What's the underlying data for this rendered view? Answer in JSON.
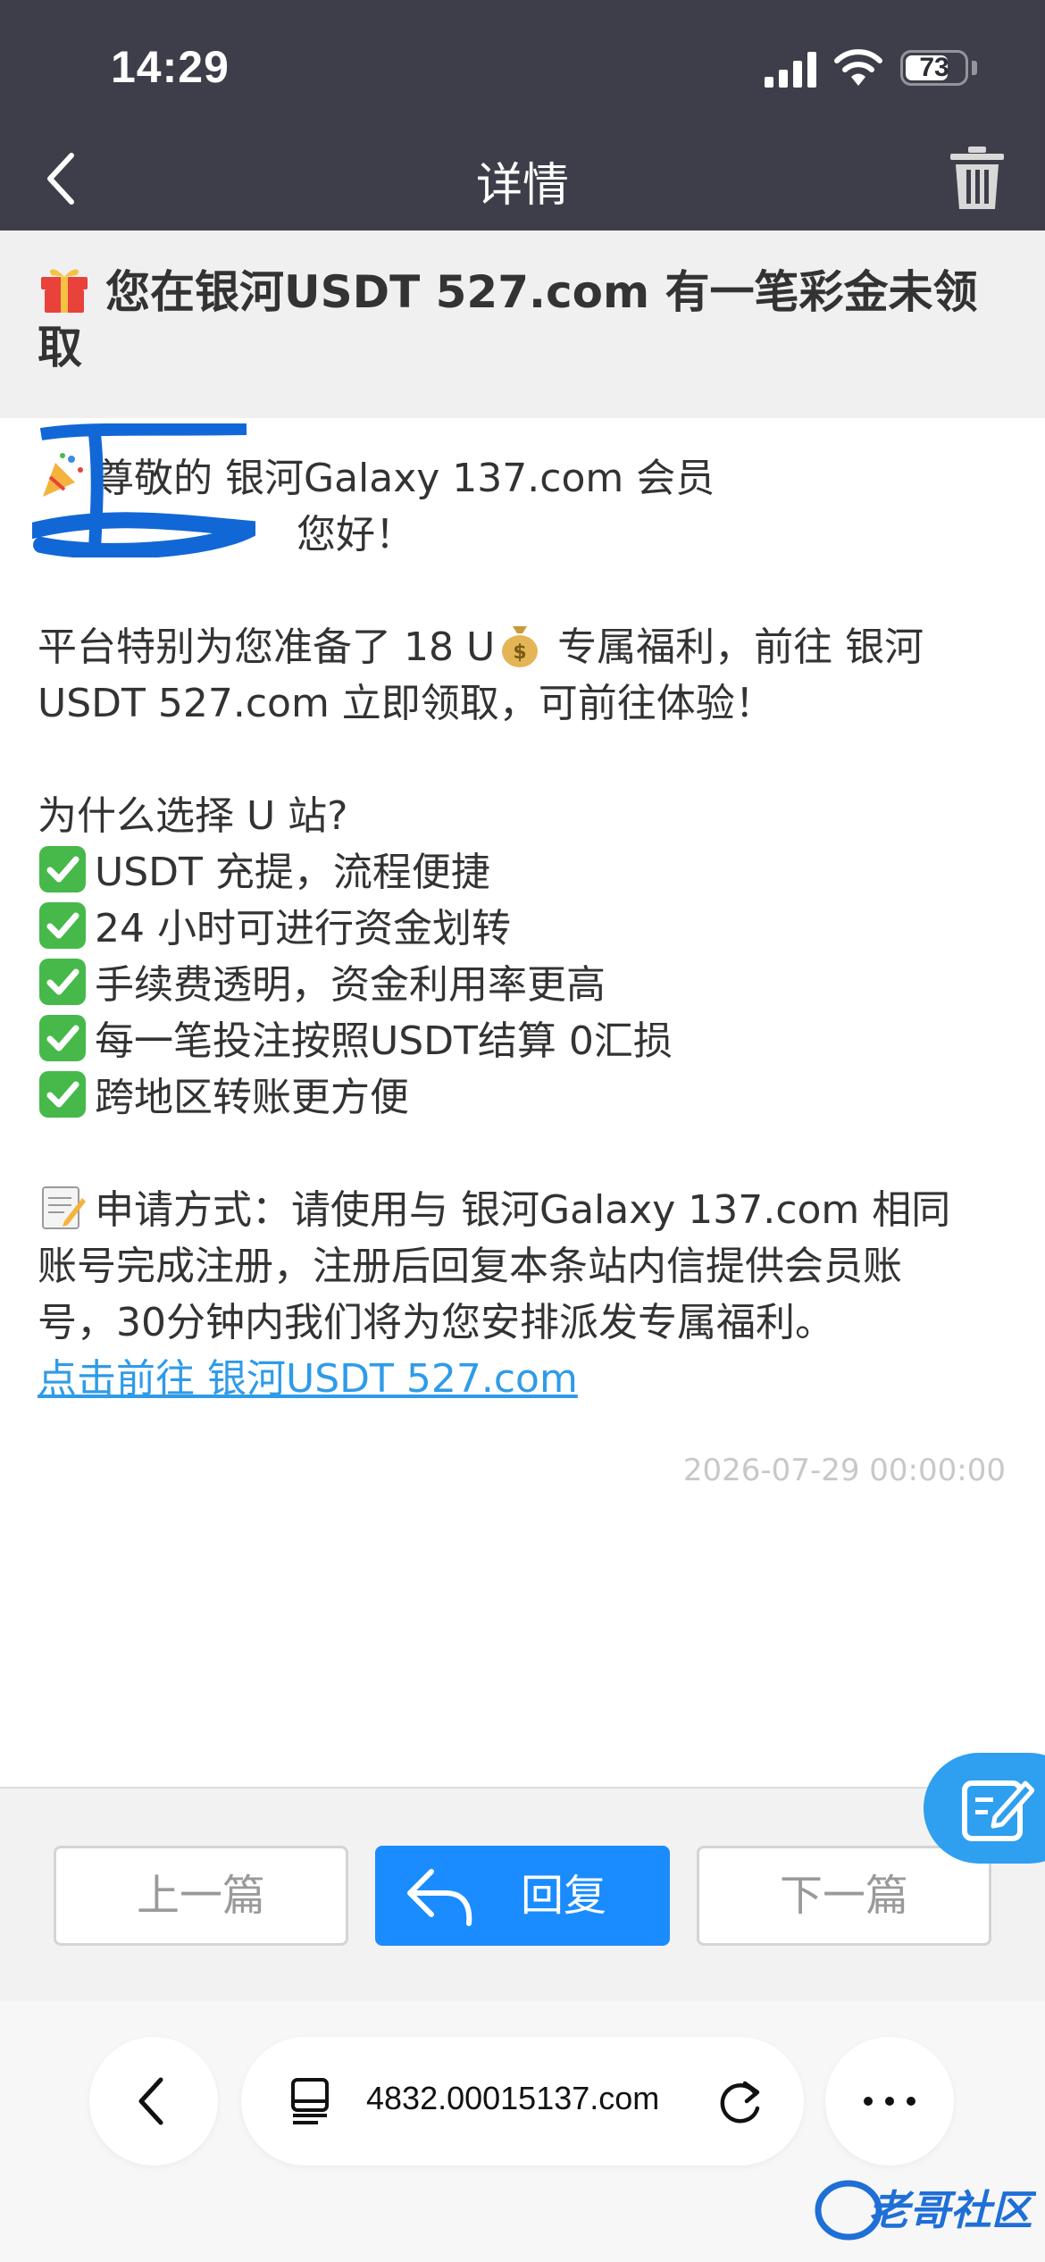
{
  "status_bar": {
    "time": "14:29",
    "battery": "73",
    "battery_level": 0.73
  },
  "nav": {
    "title": "详情",
    "back_icon": "chevron-left-icon",
    "delete_icon": "trash-icon"
  },
  "message": {
    "subject": "您在银河USDT 527.com 有一笔彩金未领取",
    "lines": {
      "greeting_1": "尊敬的 银河Galaxy 137.com 会员",
      "greeting_2": "您好！",
      "offer_1a": "平台特别为您准备了 18 U",
      "offer_1b": " 专属福利，前往 银河",
      "offer_2": "USDT 527.com 立即领取，可前往体验！",
      "why": "为什么选择 U 站?",
      "features": [
        "USDT 充提，流程便捷",
        "24 小时可进行资金划转",
        "手续费透明，资金利用率更高",
        "每一笔投注按照USDT结算 0汇损",
        "跨地区转账更方便"
      ],
      "apply_1": "申请方式：请使用与 银河Galaxy 137.com 相同",
      "apply_2": "账号完成注册，注册后回复本条站内信提供会员账",
      "apply_3": "号，30分钟内我们将为您安排派发专属福利。",
      "link": "点击前往 银河USDT 527.com"
    },
    "timestamp": "2026-07-29 00:00:00"
  },
  "actions": {
    "prev": "上一篇",
    "reply": "回复",
    "next": "下一篇"
  },
  "browser": {
    "url": "4832.00015137.com"
  },
  "watermark": "老哥社区",
  "colors": {
    "topbar": "#3d3e49",
    "link": "#2f9be8",
    "reply_button": "#1a8cff",
    "fab": "#2f9ff0",
    "check": "#46b94a"
  }
}
